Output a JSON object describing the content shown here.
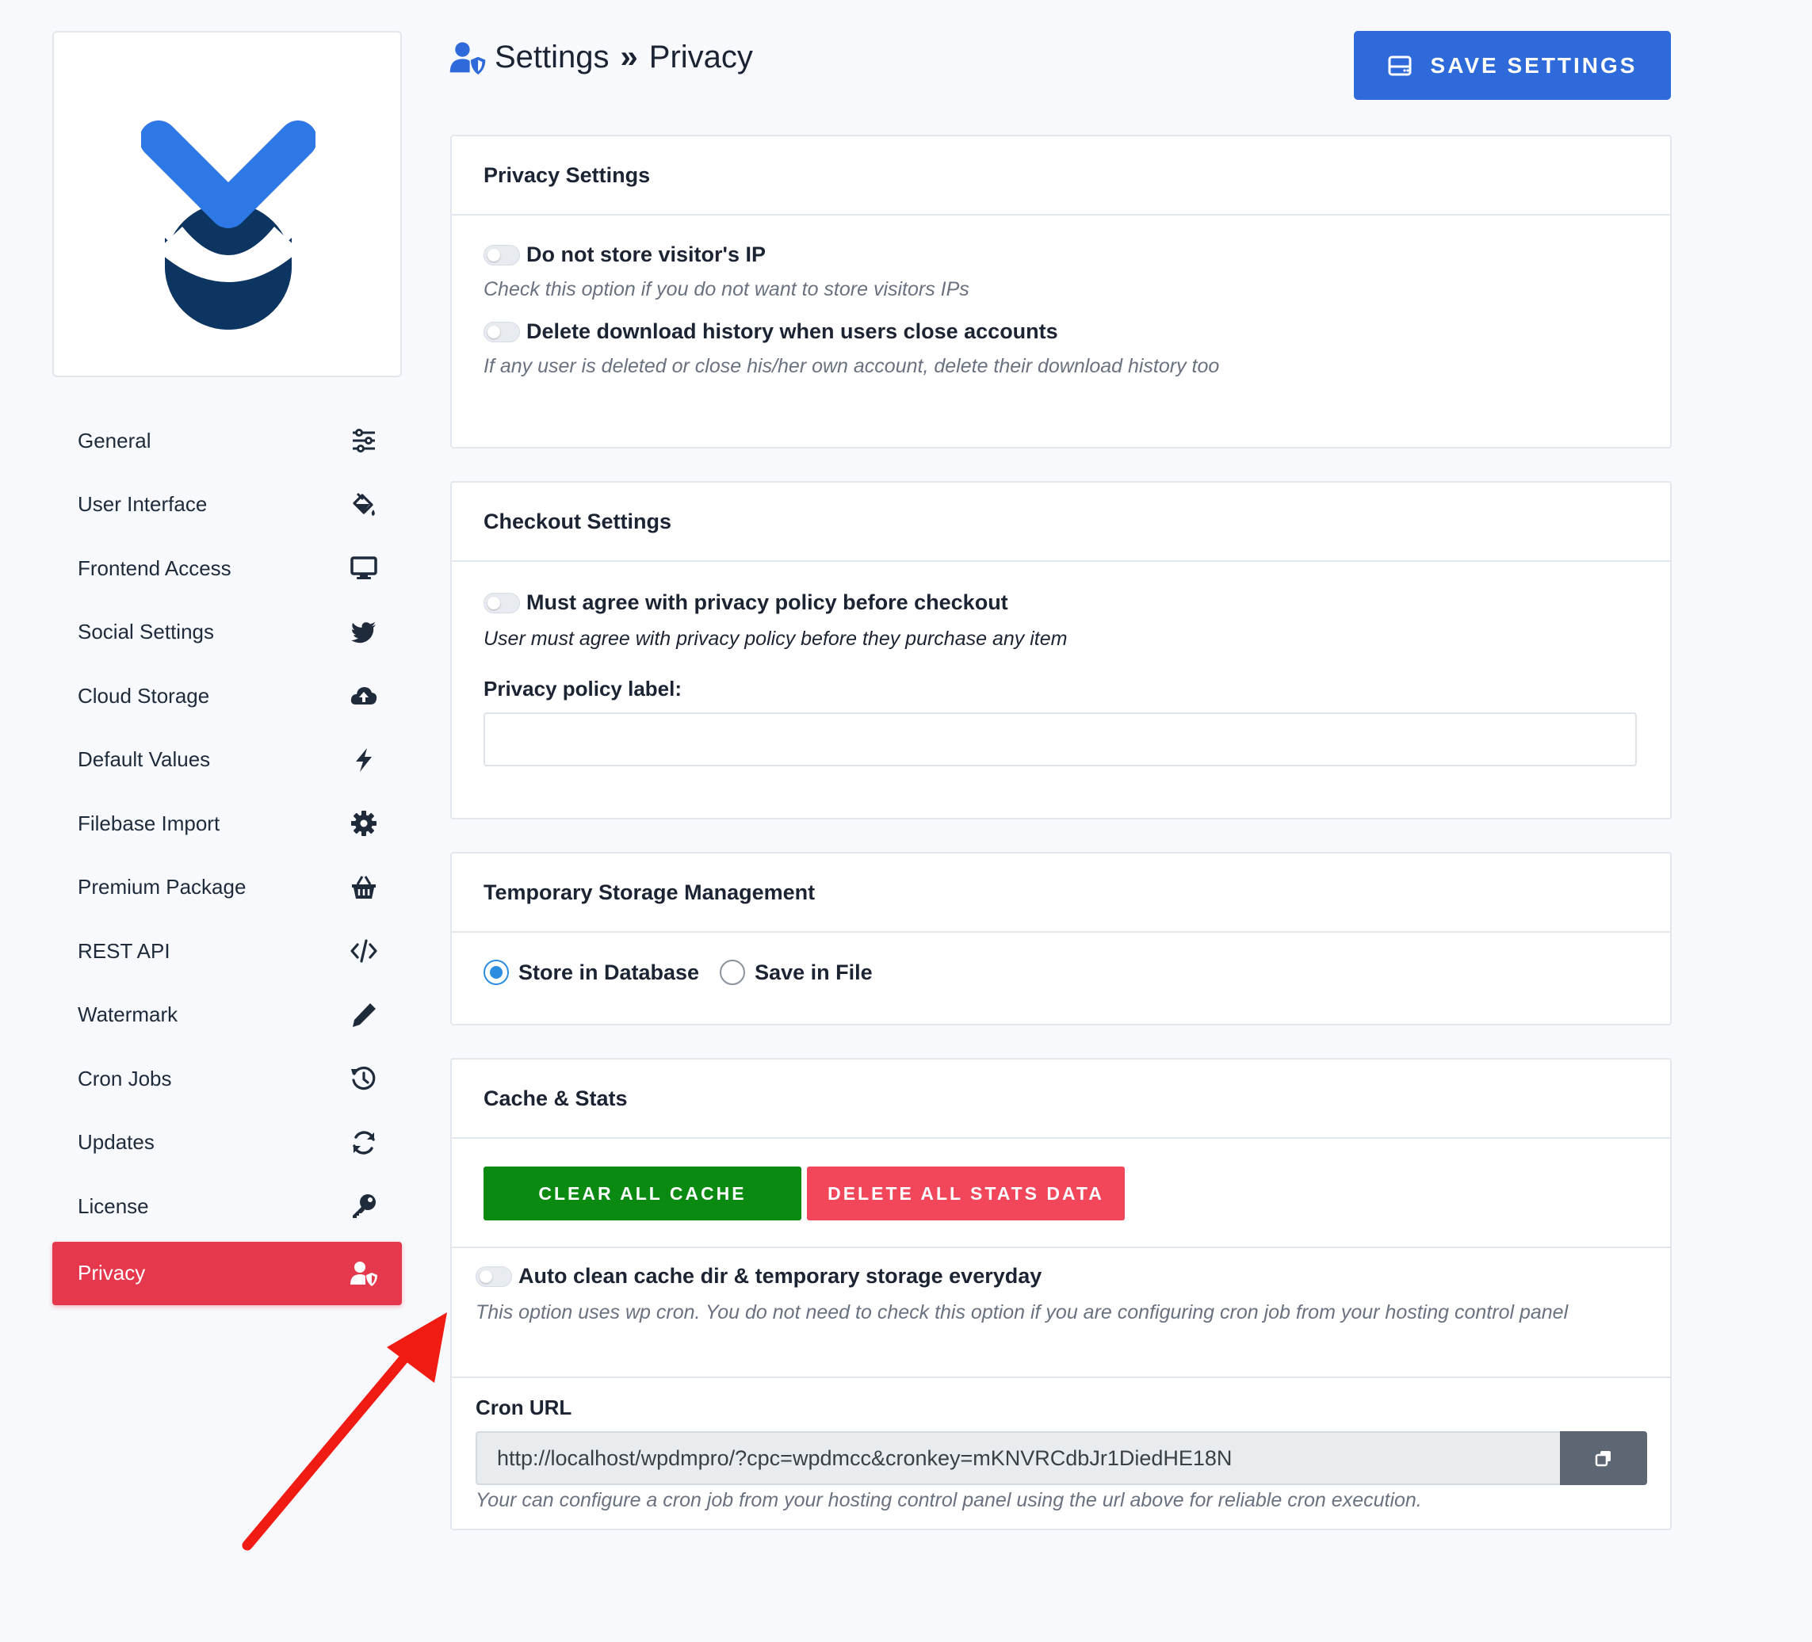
{
  "colors": {
    "accent_blue": "#2e6ad9",
    "active_red": "#e5384d",
    "green": "#0a8a10",
    "danger": "#f2465a",
    "logo_light": "#2e78e6",
    "logo_dark": "#0c3561"
  },
  "header": {
    "title": "Settings",
    "subtitle": "Privacy",
    "icon": "user-shield-icon",
    "save_label": "SAVE SETTINGS"
  },
  "sidebar": {
    "items": [
      {
        "label": "General",
        "icon": "sliders-icon"
      },
      {
        "label": "User Interface",
        "icon": "paint-bucket-icon"
      },
      {
        "label": "Frontend Access",
        "icon": "desktop-icon"
      },
      {
        "label": "Social Settings",
        "icon": "twitter-icon"
      },
      {
        "label": "Cloud Storage",
        "icon": "cloud-upload-icon"
      },
      {
        "label": "Default Values",
        "icon": "bolt-icon"
      },
      {
        "label": "Filebase Import",
        "icon": "gear-icon"
      },
      {
        "label": "Premium Package",
        "icon": "basket-icon"
      },
      {
        "label": "REST API",
        "icon": "code-icon"
      },
      {
        "label": "Watermark",
        "icon": "pen-icon"
      },
      {
        "label": "Cron Jobs",
        "icon": "history-icon"
      },
      {
        "label": "Updates",
        "icon": "sync-icon"
      },
      {
        "label": "License",
        "icon": "key-icon"
      },
      {
        "label": "Privacy",
        "icon": "user-shield-icon",
        "active": true
      }
    ]
  },
  "privacy": {
    "title": "Privacy Settings",
    "opt1_label": "Do not store visitor's IP",
    "opt1_help": "Check this option if you do not want to store visitors IPs",
    "opt2_label": "Delete download history when users close accounts",
    "opt2_help": "If any user is deleted or close his/her own account, delete their download history too"
  },
  "checkout": {
    "title": "Checkout Settings",
    "opt_label": "Must agree with privacy policy before checkout",
    "opt_help": "User must agree with privacy policy before they purchase any item",
    "field_label": "Privacy policy label:",
    "field_value": ""
  },
  "temp_storage": {
    "title": "Temporary Storage Management",
    "options": [
      "Store in Database",
      "Save in File"
    ],
    "selected": "Store in Database"
  },
  "cache": {
    "title": "Cache & Stats",
    "clear_label": "CLEAR ALL CACHE",
    "delete_label": "DELETE ALL STATS DATA",
    "auto_label": "Auto clean cache dir & temporary storage everyday",
    "auto_help": "This option uses wp cron. You do not need to check this option if you are configuring cron job from your hosting control panel",
    "cron_label": "Cron URL",
    "cron_url": "http://localhost/wpdmpro/?cpc=wpdmcc&cronkey=mKNVRCdbJr1DiedHE18N",
    "cron_help": "Your can configure a cron job from your hosting control panel using the url above for reliable cron execution."
  }
}
